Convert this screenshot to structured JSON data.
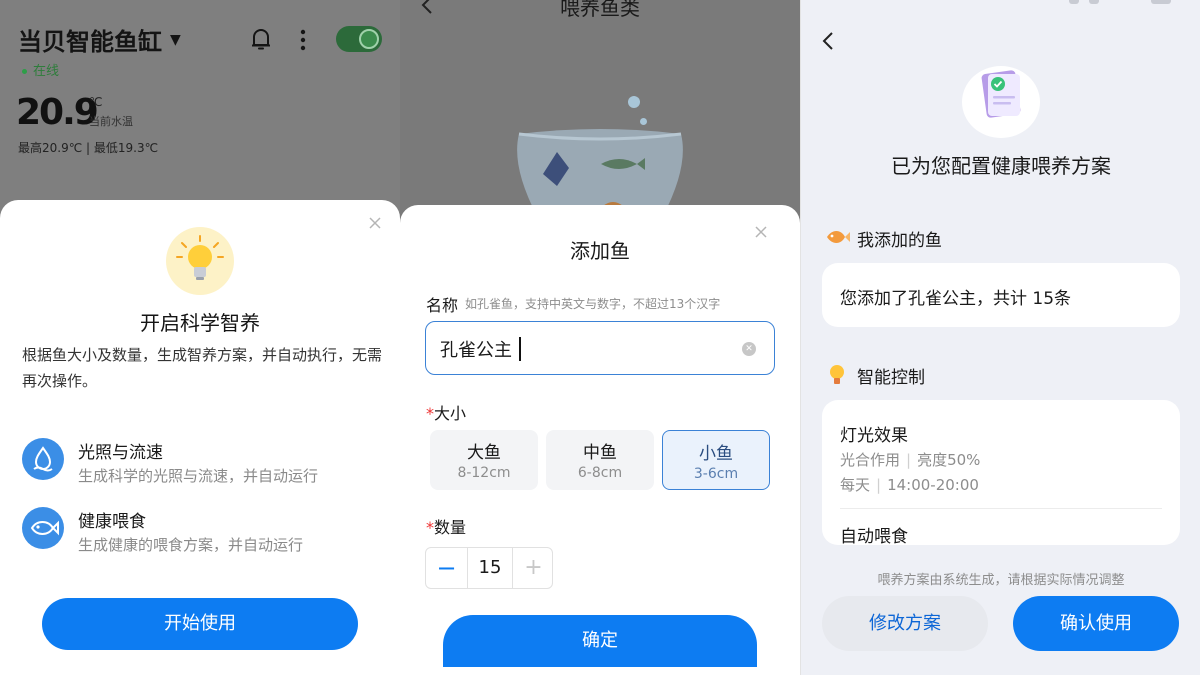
{
  "panel1": {
    "device_name": "当贝智能鱼缸",
    "status": "在线",
    "temperature": "20.9",
    "temp_unit": "℃",
    "temp_label": "当前水温",
    "temp_range": "最高20.9℃ | 最低19.3℃",
    "sheet": {
      "title": "开启科学智养",
      "description": "根据鱼大小及数量，生成智养方案，并自动执行，无需再次操作。",
      "features": [
        {
          "icon": "water-drop-icon",
          "title": "光照与流速",
          "desc": "生成科学的光照与流速，并自动运行"
        },
        {
          "icon": "fish-icon",
          "title": "健康喂食",
          "desc": "生成健康的喂食方案，并自动运行"
        }
      ],
      "start_button": "开始使用"
    }
  },
  "panel2": {
    "page_title": "喂养鱼类",
    "sheet": {
      "title": "添加鱼",
      "name_label": "名称",
      "name_hint": "如孔雀鱼，支持中英文与数字，不超过13个汉字",
      "name_value": "孔雀公主",
      "size_label": "大小",
      "required_mark": "*",
      "sizes": [
        {
          "name": "大鱼",
          "range": "8-12cm",
          "selected": false
        },
        {
          "name": "中鱼",
          "range": "6-8cm",
          "selected": false
        },
        {
          "name": "小鱼",
          "range": "3-6cm",
          "selected": true
        }
      ],
      "qty_label": "数量",
      "quantity": "15",
      "minus": "−",
      "plus": "+",
      "confirm_button": "确定"
    }
  },
  "panel3": {
    "headline": "已为您配置健康喂养方案",
    "fish_section_title": "我添加的鱼",
    "fish_summary": "您添加了孔雀公主，共计 15条",
    "control_section_title": "智能控制",
    "light": {
      "title": "灯光效果",
      "mode": "光合作用",
      "brightness": "亮度50%",
      "days": "每天",
      "time": "14:00-20:00"
    },
    "feed_title": "自动喂食",
    "note": "喂养方案由系统生成，请根据实际情况调整",
    "modify_button": "修改方案",
    "use_button": "确认使用"
  },
  "colors": {
    "primary": "#0d7cf2",
    "online_green": "#2e7d3b",
    "required_red": "#e33"
  }
}
